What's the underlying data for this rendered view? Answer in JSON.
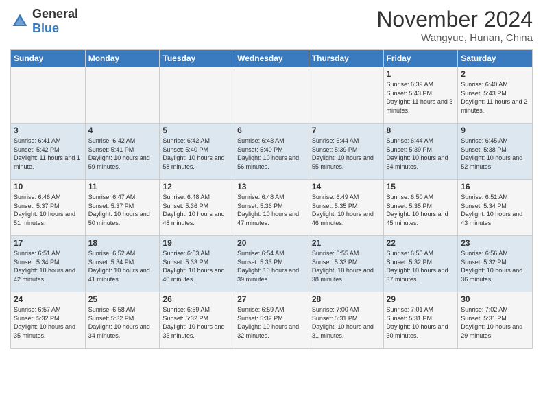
{
  "logo": {
    "general": "General",
    "blue": "Blue"
  },
  "title": "November 2024",
  "location": "Wangyue, Hunan, China",
  "days_of_week": [
    "Sunday",
    "Monday",
    "Tuesday",
    "Wednesday",
    "Thursday",
    "Friday",
    "Saturday"
  ],
  "weeks": [
    [
      {
        "day": "",
        "info": ""
      },
      {
        "day": "",
        "info": ""
      },
      {
        "day": "",
        "info": ""
      },
      {
        "day": "",
        "info": ""
      },
      {
        "day": "",
        "info": ""
      },
      {
        "day": "1",
        "info": "Sunrise: 6:39 AM\nSunset: 5:43 PM\nDaylight: 11 hours and 3 minutes."
      },
      {
        "day": "2",
        "info": "Sunrise: 6:40 AM\nSunset: 5:43 PM\nDaylight: 11 hours and 2 minutes."
      }
    ],
    [
      {
        "day": "3",
        "info": "Sunrise: 6:41 AM\nSunset: 5:42 PM\nDaylight: 11 hours and 1 minute."
      },
      {
        "day": "4",
        "info": "Sunrise: 6:42 AM\nSunset: 5:41 PM\nDaylight: 10 hours and 59 minutes."
      },
      {
        "day": "5",
        "info": "Sunrise: 6:42 AM\nSunset: 5:40 PM\nDaylight: 10 hours and 58 minutes."
      },
      {
        "day": "6",
        "info": "Sunrise: 6:43 AM\nSunset: 5:40 PM\nDaylight: 10 hours and 56 minutes."
      },
      {
        "day": "7",
        "info": "Sunrise: 6:44 AM\nSunset: 5:39 PM\nDaylight: 10 hours and 55 minutes."
      },
      {
        "day": "8",
        "info": "Sunrise: 6:44 AM\nSunset: 5:39 PM\nDaylight: 10 hours and 54 minutes."
      },
      {
        "day": "9",
        "info": "Sunrise: 6:45 AM\nSunset: 5:38 PM\nDaylight: 10 hours and 52 minutes."
      }
    ],
    [
      {
        "day": "10",
        "info": "Sunrise: 6:46 AM\nSunset: 5:37 PM\nDaylight: 10 hours and 51 minutes."
      },
      {
        "day": "11",
        "info": "Sunrise: 6:47 AM\nSunset: 5:37 PM\nDaylight: 10 hours and 50 minutes."
      },
      {
        "day": "12",
        "info": "Sunrise: 6:48 AM\nSunset: 5:36 PM\nDaylight: 10 hours and 48 minutes."
      },
      {
        "day": "13",
        "info": "Sunrise: 6:48 AM\nSunset: 5:36 PM\nDaylight: 10 hours and 47 minutes."
      },
      {
        "day": "14",
        "info": "Sunrise: 6:49 AM\nSunset: 5:35 PM\nDaylight: 10 hours and 46 minutes."
      },
      {
        "day": "15",
        "info": "Sunrise: 6:50 AM\nSunset: 5:35 PM\nDaylight: 10 hours and 45 minutes."
      },
      {
        "day": "16",
        "info": "Sunrise: 6:51 AM\nSunset: 5:34 PM\nDaylight: 10 hours and 43 minutes."
      }
    ],
    [
      {
        "day": "17",
        "info": "Sunrise: 6:51 AM\nSunset: 5:34 PM\nDaylight: 10 hours and 42 minutes."
      },
      {
        "day": "18",
        "info": "Sunrise: 6:52 AM\nSunset: 5:34 PM\nDaylight: 10 hours and 41 minutes."
      },
      {
        "day": "19",
        "info": "Sunrise: 6:53 AM\nSunset: 5:33 PM\nDaylight: 10 hours and 40 minutes."
      },
      {
        "day": "20",
        "info": "Sunrise: 6:54 AM\nSunset: 5:33 PM\nDaylight: 10 hours and 39 minutes."
      },
      {
        "day": "21",
        "info": "Sunrise: 6:55 AM\nSunset: 5:33 PM\nDaylight: 10 hours and 38 minutes."
      },
      {
        "day": "22",
        "info": "Sunrise: 6:55 AM\nSunset: 5:32 PM\nDaylight: 10 hours and 37 minutes."
      },
      {
        "day": "23",
        "info": "Sunrise: 6:56 AM\nSunset: 5:32 PM\nDaylight: 10 hours and 36 minutes."
      }
    ],
    [
      {
        "day": "24",
        "info": "Sunrise: 6:57 AM\nSunset: 5:32 PM\nDaylight: 10 hours and 35 minutes."
      },
      {
        "day": "25",
        "info": "Sunrise: 6:58 AM\nSunset: 5:32 PM\nDaylight: 10 hours and 34 minutes."
      },
      {
        "day": "26",
        "info": "Sunrise: 6:59 AM\nSunset: 5:32 PM\nDaylight: 10 hours and 33 minutes."
      },
      {
        "day": "27",
        "info": "Sunrise: 6:59 AM\nSunset: 5:32 PM\nDaylight: 10 hours and 32 minutes."
      },
      {
        "day": "28",
        "info": "Sunrise: 7:00 AM\nSunset: 5:31 PM\nDaylight: 10 hours and 31 minutes."
      },
      {
        "day": "29",
        "info": "Sunrise: 7:01 AM\nSunset: 5:31 PM\nDaylight: 10 hours and 30 minutes."
      },
      {
        "day": "30",
        "info": "Sunrise: 7:02 AM\nSunset: 5:31 PM\nDaylight: 10 hours and 29 minutes."
      }
    ]
  ]
}
